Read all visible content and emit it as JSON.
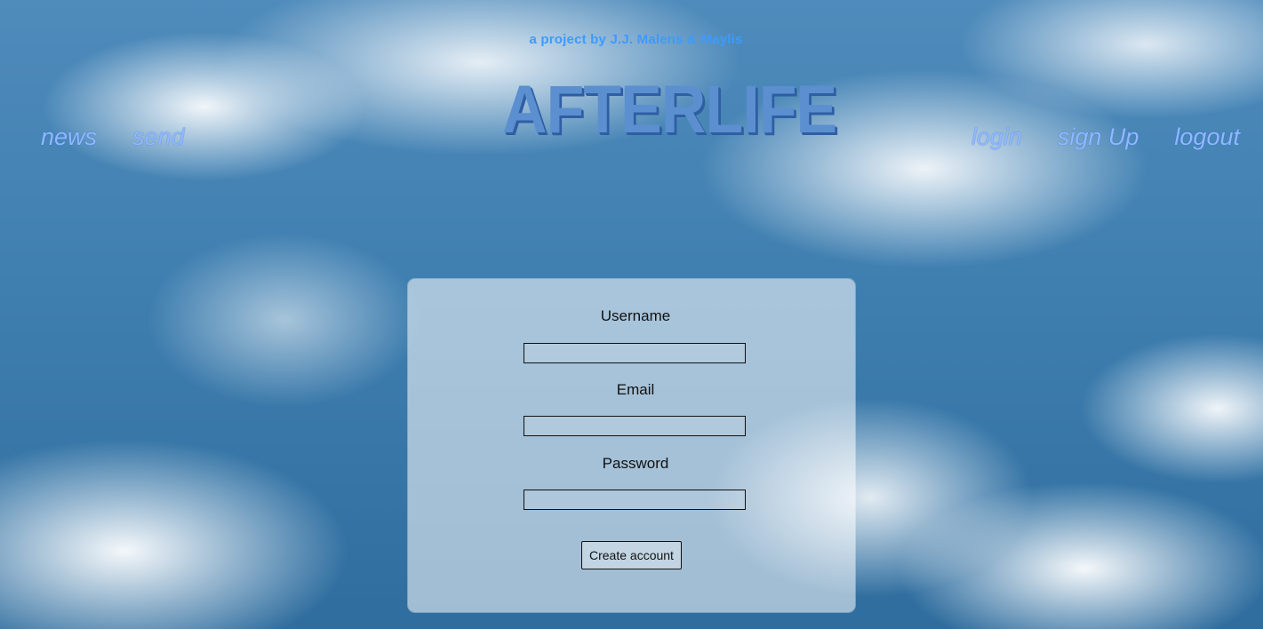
{
  "header": {
    "subtitle": "a project by J.J. Malens & Maylis",
    "logo_text": "AFTERLIFE"
  },
  "nav": {
    "left": [
      {
        "label": "news"
      },
      {
        "label": "send"
      }
    ],
    "right": [
      {
        "label": "login"
      },
      {
        "label": "sign Up"
      },
      {
        "label": "logout"
      }
    ]
  },
  "form": {
    "username_label": "Username",
    "username_value": "",
    "email_label": "Email",
    "email_value": "",
    "password_label": "Password",
    "password_value": "",
    "submit_label": "Create account"
  },
  "colors": {
    "accent": "#3e9aff",
    "nav_link": "#8fb8ff",
    "logo_fill": "#5b8fcf",
    "logo_shadow": "#2f5ea3",
    "sky_blue": "#3f7fb0"
  }
}
